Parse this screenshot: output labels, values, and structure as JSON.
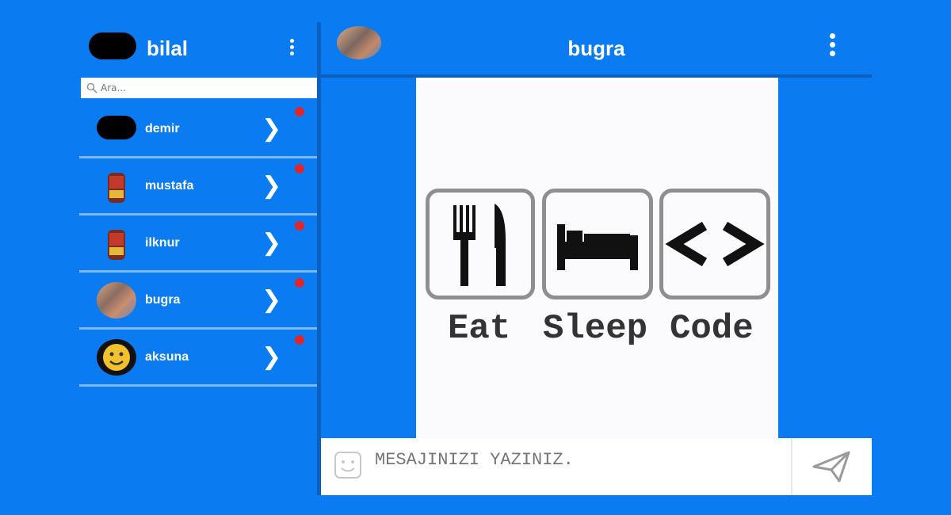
{
  "user": {
    "name": "bilal"
  },
  "search": {
    "placeholder": "Ara..."
  },
  "contacts": [
    {
      "name": "demir",
      "unread": true
    },
    {
      "name": "mustafa",
      "unread": true
    },
    {
      "name": "ilknur",
      "unread": true
    },
    {
      "name": "bugra",
      "unread": true
    },
    {
      "name": "aksuna",
      "unread": true
    }
  ],
  "chat": {
    "peer_name": "bugra",
    "image_words": {
      "eat": "Eat",
      "sleep": "Sleep",
      "code": "Code"
    },
    "code_glyph": "< >",
    "composer_placeholder": "MESAJINIZI YAZINIZ."
  },
  "colors": {
    "background": "#0b7bf2",
    "badge": "#e0262b",
    "divider": "#0a5fbf"
  },
  "icons": [
    "menu-dots-icon",
    "search-icon",
    "chevron-right-icon",
    "fork-knife-icon",
    "bed-icon",
    "emoji-icon",
    "send-icon"
  ]
}
